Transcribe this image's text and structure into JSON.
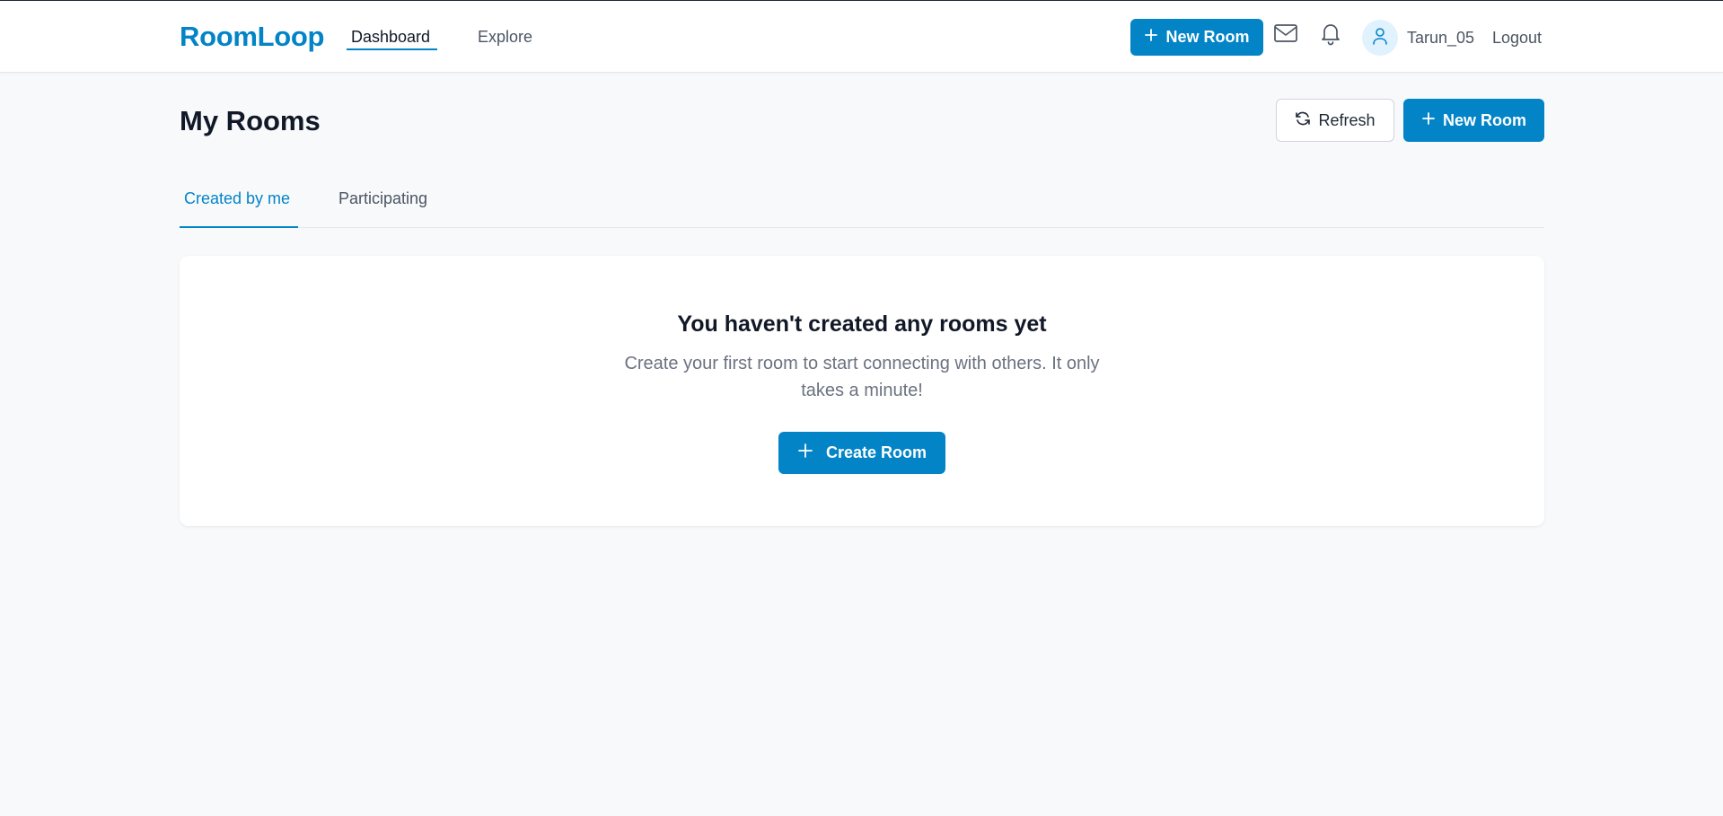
{
  "navbar": {
    "brand": "RoomLoop",
    "links": [
      {
        "label": "Dashboard",
        "active": true
      },
      {
        "label": "Explore",
        "active": false
      }
    ],
    "new_room_label": "New Room",
    "username": "Tarun_05",
    "logout_label": "Logout",
    "icons": [
      "plus-icon",
      "mail-icon",
      "bell-icon",
      "user-icon"
    ]
  },
  "page": {
    "title": "My Rooms",
    "refresh_label": "Refresh",
    "new_room_label": "New Room"
  },
  "tabs": [
    {
      "label": "Created by me",
      "active": true
    },
    {
      "label": "Participating",
      "active": false
    }
  ],
  "empty_state": {
    "title": "You haven't created any rooms yet",
    "description": "Create your first room to start connecting with others. It only takes a minute!",
    "button_label": "Create Room"
  },
  "colors": {
    "accent": "#0284c7",
    "background": "#f8f9fb",
    "text_primary": "#111827",
    "text_secondary": "#4b5563"
  }
}
